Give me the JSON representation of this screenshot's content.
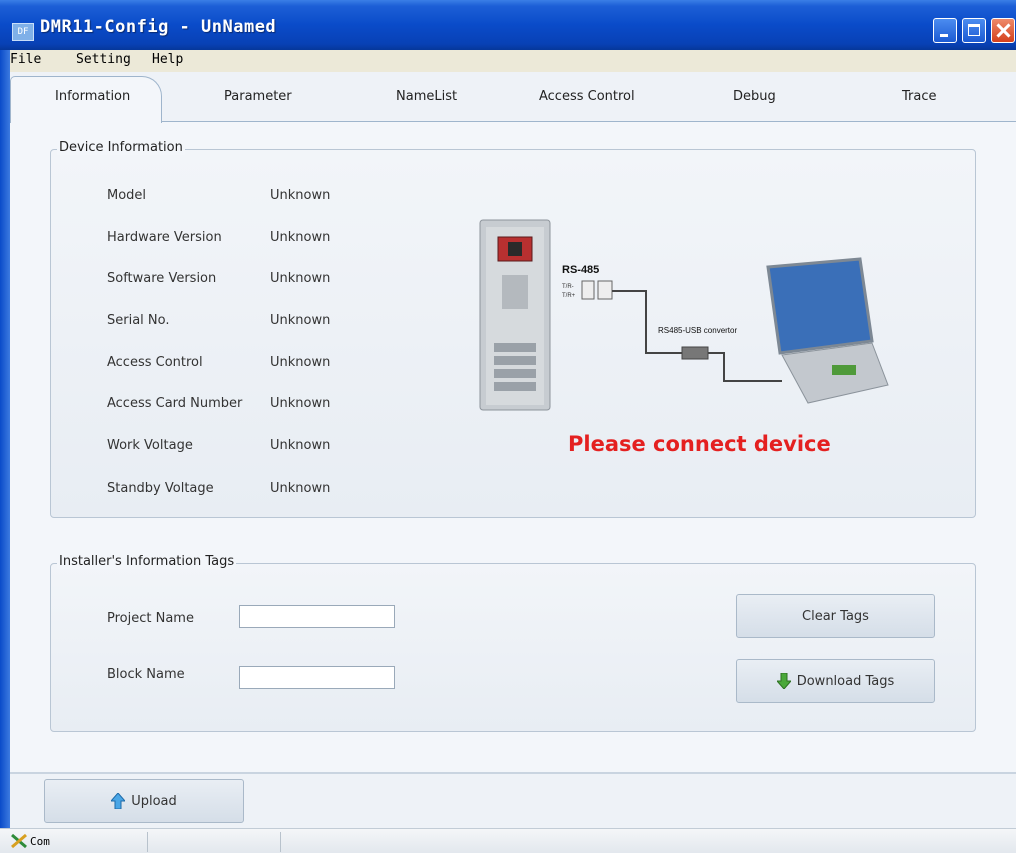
{
  "window": {
    "title": "DMR11-Config - UnNamed",
    "icon_text": "DF"
  },
  "menu": [
    "File",
    "Setting",
    "Help"
  ],
  "tabs": [
    "Information",
    "Parameter",
    "NameList",
    "Access Control",
    "Debug",
    "Trace"
  ],
  "device_info": {
    "title": "Device Information",
    "rows": [
      {
        "label": "Model",
        "value": "Unknown"
      },
      {
        "label": "Hardware Version",
        "value": "Unknown"
      },
      {
        "label": "Software Version",
        "value": "Unknown"
      },
      {
        "label": "Serial No.",
        "value": "Unknown"
      },
      {
        "label": "Access Control",
        "value": "Unknown"
      },
      {
        "label": "Access Card Number",
        "value": "Unknown"
      },
      {
        "label": "Work Voltage",
        "value": "Unknown"
      },
      {
        "label": "Standby Voltage",
        "value": "Unknown"
      }
    ],
    "diagram": {
      "rs485_label": "RS-485",
      "tr_minus": "T/R-",
      "tr_plus": "T/R+",
      "converter_label": "RS485-USB convertor"
    },
    "warning": "Please connect device"
  },
  "installer_tags": {
    "title": "Installer's Information Tags",
    "project_label": "Project Name",
    "project_value": "",
    "block_label": "Block Name",
    "block_value": "",
    "clear_button": "Clear Tags",
    "download_button": "Download Tags"
  },
  "upload_button": "Upload",
  "status": {
    "port": "Com"
  },
  "colors": {
    "warning": "#e42020",
    "title_bar": "#0a4bc9",
    "arrow": "#4aa83a"
  }
}
